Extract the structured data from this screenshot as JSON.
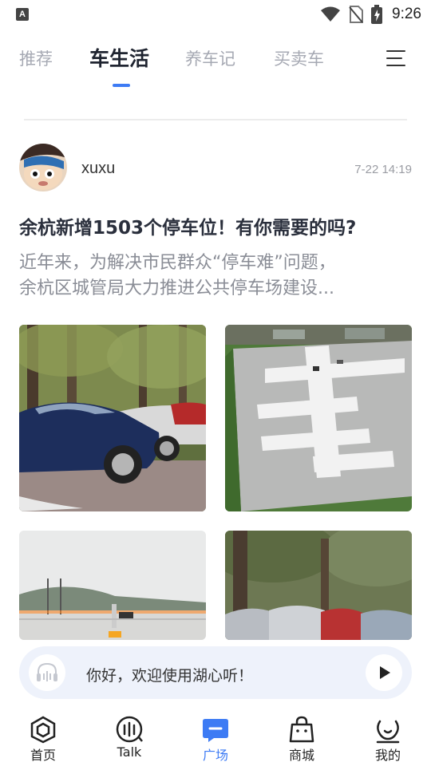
{
  "status_bar": {
    "time": "9:26",
    "notification_letter": "A"
  },
  "tabs": [
    {
      "label": "推荐",
      "active": false
    },
    {
      "label": "车生活",
      "active": true
    },
    {
      "label": "养车记",
      "active": false
    },
    {
      "label": "买卖车",
      "active": false
    }
  ],
  "post": {
    "username": "xuxu",
    "time": "7-22 14:19",
    "title": "余杭新增1503个停车位！有你需要的吗?",
    "excerpt_line1": "近年来，为解决市民群众“停车难”问题，",
    "excerpt_line2": "余杭区城管局大力推进公共停车场建设..."
  },
  "player": {
    "text": "你好，欢迎使用湖心听！"
  },
  "bottom_nav": [
    {
      "label": "首页",
      "icon": "home-icon",
      "active": false
    },
    {
      "label": "Talk",
      "icon": "talk-icon",
      "active": false
    },
    {
      "label": "广场",
      "icon": "square-icon",
      "active": true
    },
    {
      "label": "商城",
      "icon": "shop-icon",
      "active": false
    },
    {
      "label": "我的",
      "icon": "profile-icon",
      "active": false
    }
  ],
  "colors": {
    "accent": "#3d7bf4",
    "inactive_tab": "#a6a9b3",
    "title": "#2a2f3c",
    "player_bg": "#eef2fb"
  }
}
